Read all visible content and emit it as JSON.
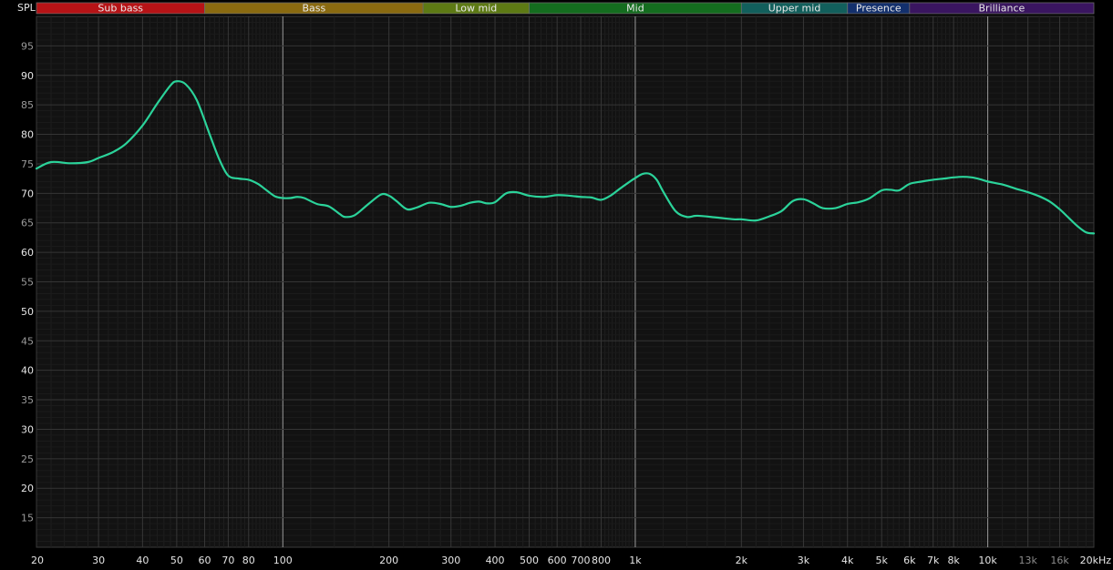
{
  "chart_data": {
    "type": "line",
    "title": "",
    "xlabel": "",
    "ylabel": "SPL",
    "xscale": "log",
    "xunit": "kHz",
    "xlim": [
      20,
      20000
    ],
    "ylim": [
      10,
      100
    ],
    "grid": true,
    "bands": [
      {
        "label": "Sub bass",
        "from": 20,
        "to": 60,
        "color": "#b61316"
      },
      {
        "label": "Bass",
        "from": 60,
        "to": 250,
        "color": "#8a6a10"
      },
      {
        "label": "Low mid",
        "from": 250,
        "to": 500,
        "color": "#5d7a14"
      },
      {
        "label": "Mid",
        "from": 500,
        "to": 2000,
        "color": "#146d1f"
      },
      {
        "label": "Upper mid",
        "from": 2000,
        "to": 4000,
        "color": "#125f5c"
      },
      {
        "label": "Presence",
        "from": 4000,
        "to": 6000,
        "color": "#13306d"
      },
      {
        "label": "Brilliance",
        "from": 6000,
        "to": 20000,
        "color": "#3a1560"
      }
    ],
    "yticks": [
      {
        "v": 15,
        "label": "15"
      },
      {
        "v": 20,
        "label": "20"
      },
      {
        "v": 25,
        "label": "25"
      },
      {
        "v": 30,
        "label": "30"
      },
      {
        "v": 35,
        "label": "35"
      },
      {
        "v": 40,
        "label": "40"
      },
      {
        "v": 45,
        "label": "45"
      },
      {
        "v": 50,
        "label": "50"
      },
      {
        "v": 55,
        "label": "55"
      },
      {
        "v": 60,
        "label": "60"
      },
      {
        "v": 65,
        "label": "65"
      },
      {
        "v": 70,
        "label": "70"
      },
      {
        "v": 75,
        "label": "75"
      },
      {
        "v": 80,
        "label": "80"
      },
      {
        "v": 85,
        "label": "85"
      },
      {
        "v": 90,
        "label": "90"
      },
      {
        "v": 95,
        "label": "95"
      }
    ],
    "xticks": [
      {
        "v": 20,
        "label": "20"
      },
      {
        "v": 30,
        "label": "30"
      },
      {
        "v": 40,
        "label": "40"
      },
      {
        "v": 50,
        "label": "50"
      },
      {
        "v": 60,
        "label": "60"
      },
      {
        "v": 70,
        "label": "70"
      },
      {
        "v": 80,
        "label": "80"
      },
      {
        "v": 100,
        "label": "100"
      },
      {
        "v": 200,
        "label": "200"
      },
      {
        "v": 300,
        "label": "300"
      },
      {
        "v": 400,
        "label": "400"
      },
      {
        "v": 500,
        "label": "500"
      },
      {
        "v": 600,
        "label": "600"
      },
      {
        "v": 700,
        "label": "700"
      },
      {
        "v": 800,
        "label": "800"
      },
      {
        "v": 1000,
        "label": "1k"
      },
      {
        "v": 2000,
        "label": "2k"
      },
      {
        "v": 3000,
        "label": "3k"
      },
      {
        "v": 4000,
        "label": "4k"
      },
      {
        "v": 5000,
        "label": "5k"
      },
      {
        "v": 6000,
        "label": "6k"
      },
      {
        "v": 7000,
        "label": "7k"
      },
      {
        "v": 8000,
        "label": "8k"
      },
      {
        "v": 10000,
        "label": "10k"
      },
      {
        "v": 13000,
        "label": "13k",
        "dim": true
      },
      {
        "v": 16000,
        "label": "16k",
        "dim": true
      },
      {
        "v": 20000,
        "label": "20kHz"
      }
    ],
    "series": [
      {
        "color": "#2bd39a",
        "x": [
          20,
          22,
          25,
          28,
          30,
          33,
          36,
          40,
          44,
          48,
          50,
          53,
          57,
          62,
          66,
          70,
          75,
          80,
          85,
          90,
          95,
          100,
          105,
          110,
          115,
          125,
          135,
          145,
          150,
          160,
          175,
          190,
          200,
          210,
          225,
          240,
          260,
          280,
          300,
          320,
          340,
          360,
          380,
          400,
          430,
          460,
          500,
          550,
          600,
          650,
          700,
          750,
          800,
          850,
          900,
          950,
          1000,
          1050,
          1100,
          1150,
          1200,
          1300,
          1400,
          1500,
          1700,
          1900,
          2000,
          2200,
          2400,
          2600,
          2800,
          3000,
          3200,
          3400,
          3700,
          4000,
          4300,
          4600,
          5000,
          5300,
          5600,
          6000,
          6500,
          7000,
          7500,
          8000,
          8500,
          9000,
          9500,
          10000,
          11000,
          12000,
          13000,
          14000,
          15000,
          16000,
          17000,
          18000,
          19000,
          20000
        ],
        "y": [
          74.2,
          75.3,
          75.1,
          75.3,
          76.0,
          77.0,
          78.5,
          81.5,
          85.2,
          88.3,
          89.0,
          88.5,
          85.8,
          80.0,
          75.8,
          73.0,
          72.5,
          72.3,
          71.6,
          70.5,
          69.5,
          69.2,
          69.2,
          69.4,
          69.2,
          68.2,
          67.8,
          66.5,
          66.0,
          66.3,
          68.2,
          69.8,
          69.6,
          68.7,
          67.3,
          67.6,
          68.4,
          68.2,
          67.7,
          67.9,
          68.4,
          68.6,
          68.3,
          68.5,
          70.0,
          70.2,
          69.6,
          69.4,
          69.7,
          69.6,
          69.4,
          69.3,
          68.9,
          69.6,
          70.7,
          71.7,
          72.6,
          73.3,
          73.3,
          72.3,
          70.3,
          67.0,
          66.0,
          66.2,
          65.9,
          65.6,
          65.6,
          65.4,
          66.1,
          67.0,
          68.7,
          69.0,
          68.3,
          67.5,
          67.5,
          68.2,
          68.5,
          69.1,
          70.5,
          70.6,
          70.5,
          71.6,
          72.0,
          72.3,
          72.5,
          72.7,
          72.8,
          72.7,
          72.4,
          72.0,
          71.5,
          70.8,
          70.2,
          69.5,
          68.6,
          67.3,
          65.8,
          64.4,
          63.4,
          63.2
        ]
      }
    ]
  }
}
